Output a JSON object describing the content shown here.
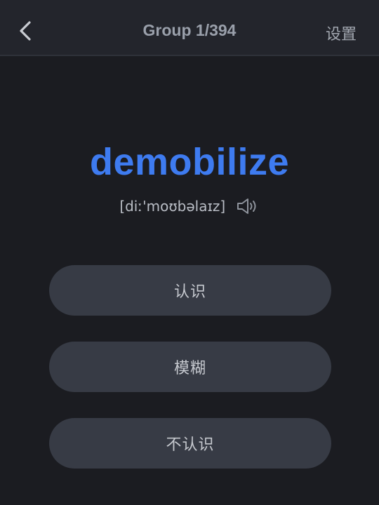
{
  "header": {
    "title": "Group 1/394",
    "settings_label": "设置",
    "back_icon": "chevron-left-icon"
  },
  "word": {
    "text": "demobilize",
    "phonetic": "[diː'moʊbəlaɪz]",
    "speaker_icon": "speaker-icon"
  },
  "choices": [
    {
      "label": "认识"
    },
    {
      "label": "模糊"
    },
    {
      "label": "不认识"
    }
  ],
  "colors": {
    "background": "#1b1c21",
    "header": "#23252c",
    "accent": "#3e7bf0",
    "button": "#373b45"
  }
}
